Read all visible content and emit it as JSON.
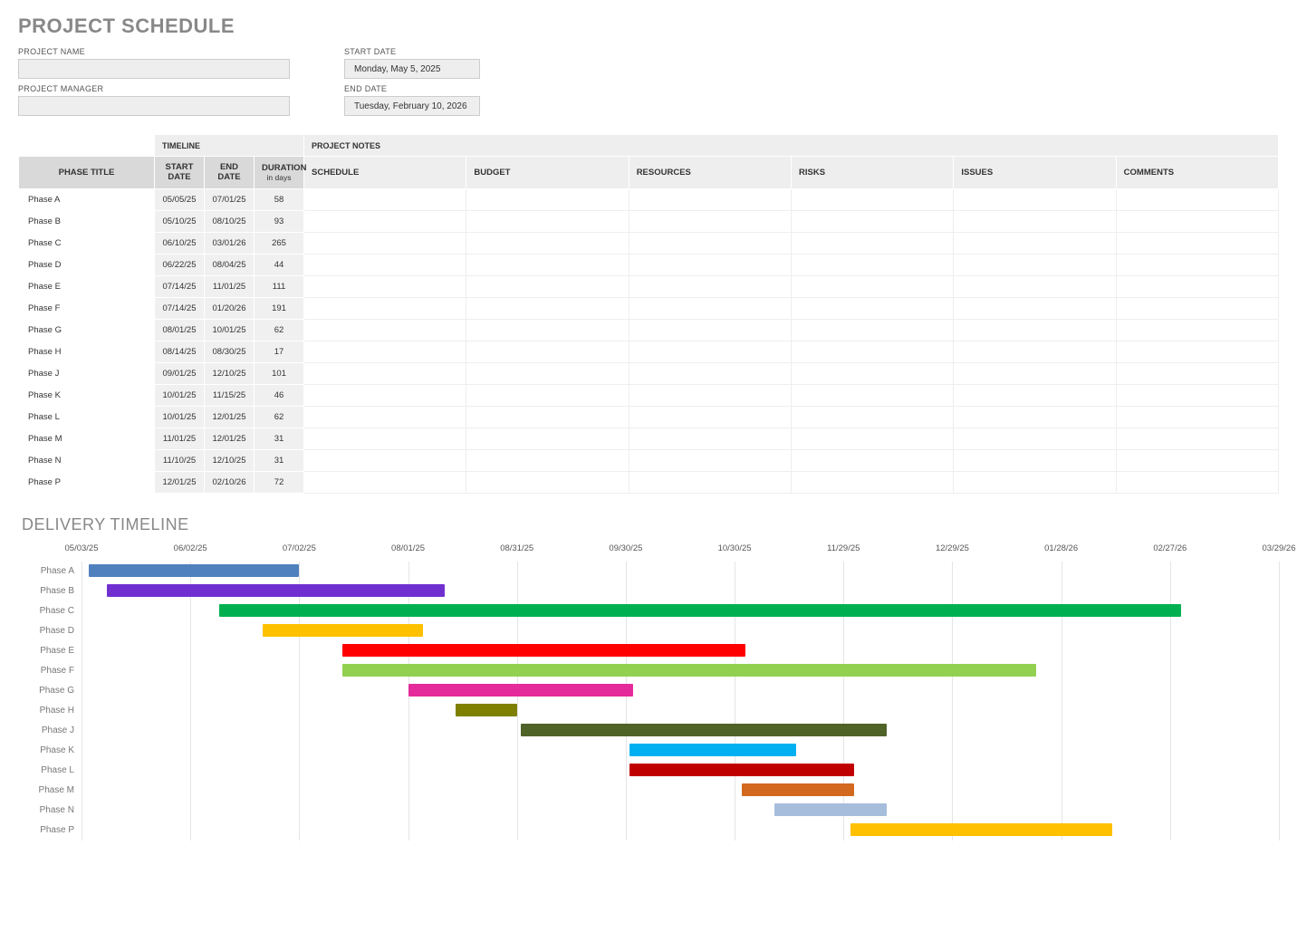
{
  "title": "PROJECT SCHEDULE",
  "meta": {
    "project_name_label": "PROJECT NAME",
    "project_name_value": "",
    "project_manager_label": "PROJECT MANAGER",
    "project_manager_value": "",
    "start_date_label": "START DATE",
    "start_date_value": "Monday, May 5, 2025",
    "end_date_label": "END DATE",
    "end_date_value": "Tuesday, February 10, 2026"
  },
  "table": {
    "group_timeline": "TIMELINE",
    "group_notes": "PROJECT NOTES",
    "headers": {
      "phase_title": "PHASE TITLE",
      "start_date": "START DATE",
      "end_date": "END DATE",
      "duration": "DURATION",
      "duration_sub": "in days",
      "schedule": "SCHEDULE",
      "budget": "BUDGET",
      "resources": "RESOURCES",
      "risks": "RISKS",
      "issues": "ISSUES",
      "comments": "COMMENTS"
    },
    "rows": [
      {
        "phase": "Phase A",
        "start": "05/05/25",
        "end": "07/01/25",
        "duration": "58"
      },
      {
        "phase": "Phase B",
        "start": "05/10/25",
        "end": "08/10/25",
        "duration": "93"
      },
      {
        "phase": "Phase C",
        "start": "06/10/25",
        "end": "03/01/26",
        "duration": "265"
      },
      {
        "phase": "Phase D",
        "start": "06/22/25",
        "end": "08/04/25",
        "duration": "44"
      },
      {
        "phase": "Phase E",
        "start": "07/14/25",
        "end": "11/01/25",
        "duration": "111"
      },
      {
        "phase": "Phase F",
        "start": "07/14/25",
        "end": "01/20/26",
        "duration": "191"
      },
      {
        "phase": "Phase G",
        "start": "08/01/25",
        "end": "10/01/25",
        "duration": "62"
      },
      {
        "phase": "Phase H",
        "start": "08/14/25",
        "end": "08/30/25",
        "duration": "17"
      },
      {
        "phase": "Phase J",
        "start": "09/01/25",
        "end": "12/10/25",
        "duration": "101"
      },
      {
        "phase": "Phase K",
        "start": "10/01/25",
        "end": "11/15/25",
        "duration": "46"
      },
      {
        "phase": "Phase L",
        "start": "10/01/25",
        "end": "12/01/25",
        "duration": "62"
      },
      {
        "phase": "Phase M",
        "start": "11/01/25",
        "end": "12/01/25",
        "duration": "31"
      },
      {
        "phase": "Phase N",
        "start": "11/10/25",
        "end": "12/10/25",
        "duration": "31"
      },
      {
        "phase": "Phase P",
        "start": "12/01/25",
        "end": "02/10/26",
        "duration": "72"
      }
    ]
  },
  "delivery_title": "DELIVERY TIMELINE",
  "chart_data": {
    "type": "bar",
    "orientation": "horizontal-gantt",
    "x_axis_ticks": [
      "05/03/25",
      "06/02/25",
      "07/02/25",
      "08/01/25",
      "08/31/25",
      "09/30/25",
      "10/30/25",
      "11/29/25",
      "12/29/25",
      "01/28/26",
      "02/27/26",
      "03/29/26"
    ],
    "x_range_days": 330,
    "x_origin": "05/03/25",
    "series": [
      {
        "name": "Phase A",
        "start_offset_days": 2,
        "duration_days": 58,
        "color": "#4F81BD"
      },
      {
        "name": "Phase B",
        "start_offset_days": 7,
        "duration_days": 93,
        "color": "#7030D0"
      },
      {
        "name": "Phase C",
        "start_offset_days": 38,
        "duration_days": 265,
        "color": "#00B050"
      },
      {
        "name": "Phase D",
        "start_offset_days": 50,
        "duration_days": 44,
        "color": "#FFC000"
      },
      {
        "name": "Phase E",
        "start_offset_days": 72,
        "duration_days": 111,
        "color": "#FF0000"
      },
      {
        "name": "Phase F",
        "start_offset_days": 72,
        "duration_days": 191,
        "color": "#92D050"
      },
      {
        "name": "Phase G",
        "start_offset_days": 90,
        "duration_days": 62,
        "color": "#E52B9B"
      },
      {
        "name": "Phase H",
        "start_offset_days": 103,
        "duration_days": 17,
        "color": "#808000"
      },
      {
        "name": "Phase J",
        "start_offset_days": 121,
        "duration_days": 101,
        "color": "#4F6228"
      },
      {
        "name": "Phase K",
        "start_offset_days": 151,
        "duration_days": 46,
        "color": "#00B0F0"
      },
      {
        "name": "Phase L",
        "start_offset_days": 151,
        "duration_days": 62,
        "color": "#C00000"
      },
      {
        "name": "Phase M",
        "start_offset_days": 182,
        "duration_days": 31,
        "color": "#D2691E"
      },
      {
        "name": "Phase N",
        "start_offset_days": 191,
        "duration_days": 31,
        "color": "#A6BDDB"
      },
      {
        "name": "Phase P",
        "start_offset_days": 212,
        "duration_days": 72,
        "color": "#FFC000"
      }
    ]
  }
}
